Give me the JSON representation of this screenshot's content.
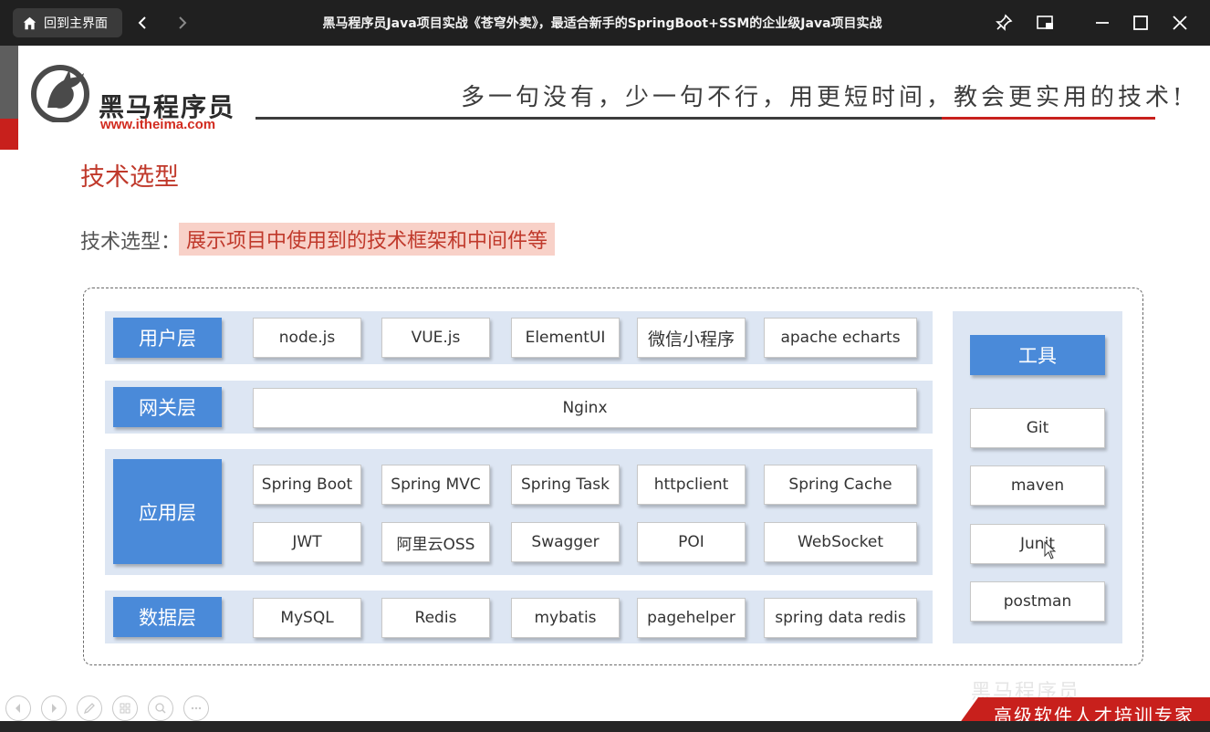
{
  "titlebar": {
    "home_label": "回到主界面",
    "title": "黑马程序员Java项目实战《苍穹外卖》，最适合新手的SpringBoot+SSM的企业级Java项目实战"
  },
  "slide": {
    "logo_cn": "黑马程序员",
    "logo_url": "www.itheima.com",
    "slogan": "多一句没有，少一句不行，用更短时间，教会更实用的技术!",
    "section_title": "技术选型",
    "sub_label": "技术选型：",
    "sub_highlight": "展示项目中使用到的技术框架和中间件等",
    "layers": [
      {
        "name": "用户层",
        "items": [
          "node.js",
          "VUE.js",
          "ElementUI",
          "微信小程序",
          "apache echarts"
        ]
      },
      {
        "name": "网关层",
        "items": [
          "Nginx"
        ]
      },
      {
        "name": "应用层",
        "items": [
          "Spring Boot",
          "Spring MVC",
          "Spring Task",
          "httpclient",
          "Spring Cache",
          "JWT",
          "阿里云OSS",
          "Swagger",
          "POI",
          "WebSocket"
        ]
      },
      {
        "name": "数据层",
        "items": [
          "MySQL",
          "Redis",
          "mybatis",
          "pagehelper",
          "spring data redis"
        ]
      }
    ],
    "tools": {
      "title": "工具",
      "items": [
        "Git",
        "maven",
        "Junit",
        "postman"
      ]
    },
    "watermark": "黑马程序员",
    "banner": "高级软件人才培训专家"
  },
  "colors": {
    "accent_red": "#c8201c",
    "layer_blue": "#4a8ad9",
    "layer_bg": "#dde6f3",
    "highlight_bg": "#f8d1c8"
  }
}
